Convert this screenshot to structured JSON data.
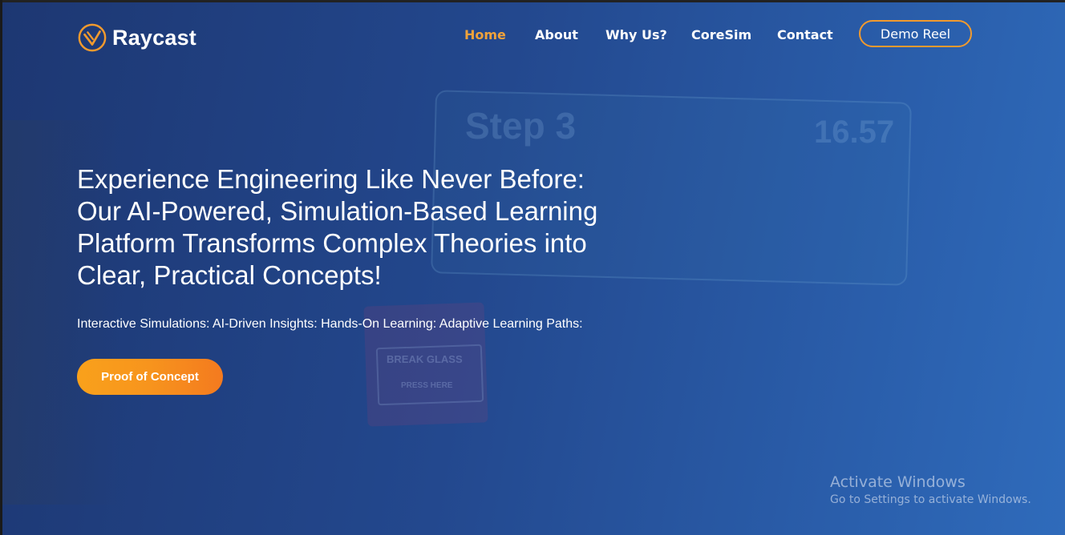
{
  "brand": {
    "name": "Raycast",
    "accent": "#f29a2e"
  },
  "nav": {
    "items": [
      {
        "label": "Home",
        "active": true
      },
      {
        "label": "About",
        "active": false
      },
      {
        "label": "Why Us?",
        "active": false
      },
      {
        "label": "CoreSim",
        "active": false
      },
      {
        "label": "Contact",
        "active": false
      }
    ],
    "cta_label": "Demo Reel"
  },
  "hero": {
    "title_lines": [
      "Experience Engineering Like Never Before:",
      "Our AI-Powered, Simulation-Based Learning",
      "Platform Transforms Complex Theories into",
      "Clear, Practical Concepts!"
    ],
    "subtitle": "Interactive Simulations: AI-Driven Insights: Hands-On Learning: Adaptive Learning Paths:",
    "cta_label": "Proof of Concept",
    "cta_color": "#f7941d"
  },
  "background_scene": {
    "sign_heading": "Step 3",
    "sign_value": "16.57",
    "box_label_top": "BREAK GLASS",
    "box_label_bottom": "PRESS HERE"
  },
  "watermark": {
    "title": "Activate Windows",
    "subtitle": "Go to Settings to activate Windows."
  }
}
